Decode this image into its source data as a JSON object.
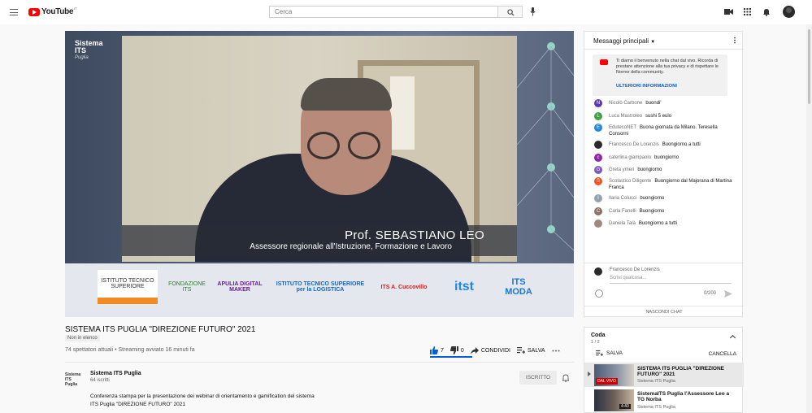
{
  "header": {
    "logo_text": "YouTube",
    "logo_sup": "IT",
    "search_placeholder": "Cerca"
  },
  "video": {
    "brand_top_line1": "Sistema",
    "brand_top_line2": "ITS",
    "brand_top_line3": "Puglia",
    "lower_third_name": "Prof. SEBASTIANO LEO",
    "lower_third_role": "Assessore regionale all'Istruzione, Formazione e Lavoro",
    "sponsor_logos": [
      "ISTITUTO TECNICO SUPERIORE",
      "FONDAZIONE ITS",
      "APULIA DIGITAL MAKER",
      "ISTITUTO TECNICO SUPERIORE per la LOGISTICA",
      "ITS A. Cuccovillo",
      "itst",
      "ITS MODA"
    ]
  },
  "info": {
    "title": "SISTEMA ITS PUGLIA \"DIREZIONE FUTURO\" 2021",
    "unlisted_badge": "Non in elenco",
    "meta": "74 spettatori attuali • Streaming avviato 16 minuti fa",
    "like_count": "7",
    "dislike_count": "0",
    "share_label": "CONDIVIDI",
    "save_label": "SALVA",
    "like_ratio": 1.0
  },
  "channel": {
    "logo_text": "Sistema ITS Puglia",
    "name": "Sistema ITS Puglia",
    "subscribers": "64 iscritti",
    "subscribe_label": "ISCRITTO",
    "description_line1": "Conferenza stampa per la presentazione dei webinar di orientamento e gamification del sistema",
    "description_line2": "ITS Puglia \"DIREZIONE FUTURO\" 2021"
  },
  "chat": {
    "header_label": "Messaggi principali",
    "welcome_text": "Ti diamo il benvenuto nella chat dal vivo. Ricorda di prestare attenzione alla tua privacy e di rispettare le Norme della community.",
    "welcome_link": "ULTERIORI INFORMAZIONI",
    "messages": [
      {
        "author": "Nicolò Carbone",
        "text": "buondi'",
        "initial": "N",
        "color": "#5e35b1"
      },
      {
        "author": "Luca Mastroleo",
        "text": "sushi 5 eulo",
        "initial": "L",
        "color": "#43a047"
      },
      {
        "author": "EdutecoNET",
        "text": "Buona giornata da Milano. Teresella Consorni",
        "initial": "E",
        "color": "#1e88e5"
      },
      {
        "author": "Francesco De Lorenzis",
        "text": "Buongiorno a tutti",
        "initial": "",
        "color": "#2a2a2a"
      },
      {
        "author": "caterlina giampaolo",
        "text": "buongiorno",
        "initial": "c",
        "color": "#8e24aa"
      },
      {
        "author": "Greta ymeri",
        "text": "buongiorno",
        "initial": "G",
        "color": "#7e57c2"
      },
      {
        "author": "Scolastico Diligente",
        "text": "Buongiorno dal Majorana di Martina Franca",
        "initial": "S",
        "color": "#f4511e"
      },
      {
        "author": "Ilaria Colucci",
        "text": "buongiorno",
        "initial": "I",
        "color": "#90a4ae"
      },
      {
        "author": "Carla Fanelli",
        "text": "Buongiorno",
        "initial": "C",
        "color": "#8d6e63"
      },
      {
        "author": "Daniela Talà",
        "text": "Buongiorno a tutti",
        "initial": "",
        "color": "#a1887f"
      }
    ],
    "input_user": "Francesco De Lorenzis",
    "input_placeholder": "Scrivi qualcosa...",
    "char_counter": "0/200",
    "hide_chat_label": "NASCONDI CHAT"
  },
  "queue": {
    "title": "Coda",
    "count": "1 / 2",
    "save_label": "SALVA",
    "cancel_label": "CANCELLA",
    "items": [
      {
        "title": "SISTEMA ITS PUGLIA \"DIREZIONE FUTURO\" 2021",
        "channel": "Sistema ITS Puglia",
        "badge": "DAL VIVO"
      },
      {
        "title": "SistemaITS Puglia l'Assessore Leo a TG Norba",
        "channel": "Sistema ITS Puglia",
        "badge": "4:40"
      }
    ]
  }
}
